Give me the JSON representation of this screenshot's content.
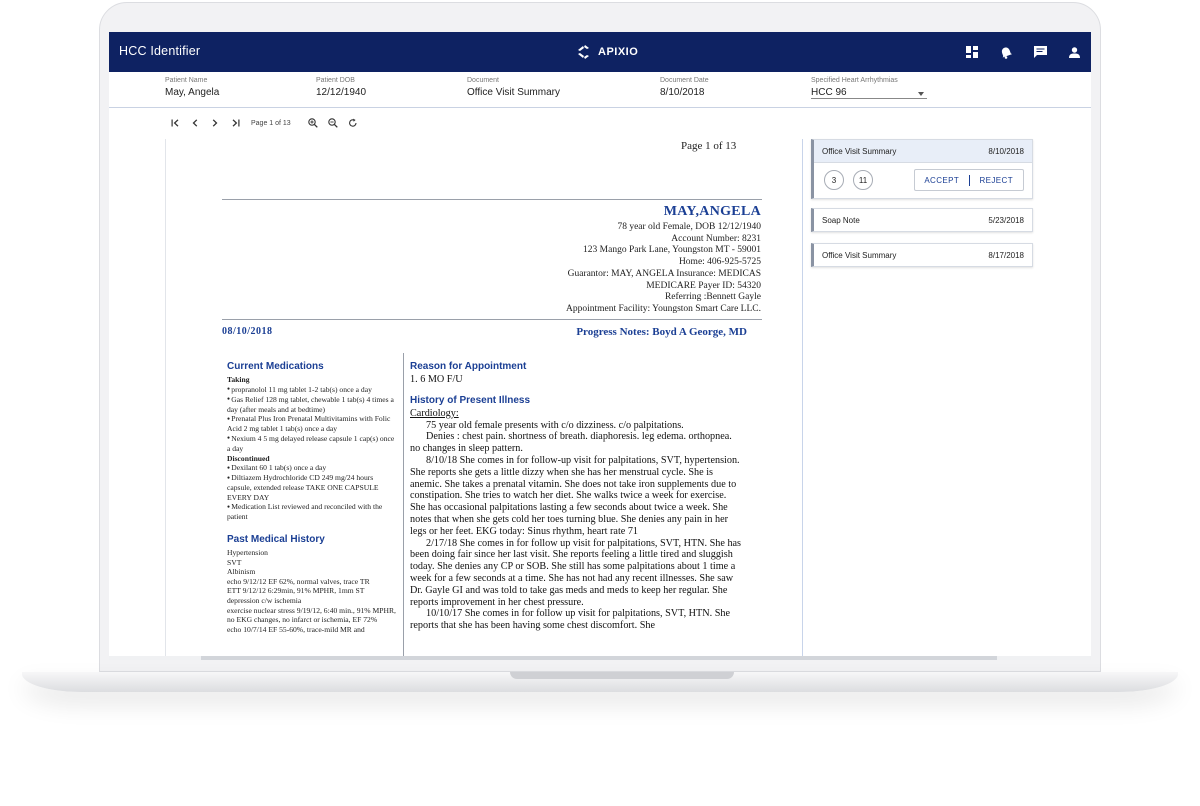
{
  "header": {
    "title": "HCC Identifier",
    "brand": "APIXIO"
  },
  "top_icons": [
    "dashboard-icon",
    "notification-bell-icon",
    "chat-icon",
    "user-icon"
  ],
  "meta": [
    {
      "label": "Patient Name",
      "value": "May, Angela"
    },
    {
      "label": "Patient DOB",
      "value": "12/12/1940"
    },
    {
      "label": "Document",
      "value": "Office Visit Summary"
    },
    {
      "label": "Document Date",
      "value": "8/10/2018"
    },
    {
      "label": "Specified Heart Arrhythmias",
      "value": "HCC 96"
    }
  ],
  "pager": {
    "page_info": "Page 1 of 13"
  },
  "document": {
    "page_label": "Page 1 of 13",
    "patient_name": "MAY,ANGELA",
    "address_lines": [
      "78  year old Female, DOB 12/12/1940",
      "Account Number: 8231",
      "123 Mango Park Lane, Youngston MT - 59001",
      "Home: 406-925-5725",
      "Guarantor: MAY, ANGELA Insurance: MEDICAS",
      "MEDICARE Payer ID: 54320",
      "Referring :Bennett Gayle",
      "Appointment Facility: Youngston Smart Care LLC."
    ],
    "visit_date": "08/10/2018",
    "progress_notes": "Progress Notes:  Boyd A George, MD",
    "current_medications_title": "Current Medications",
    "taking_label": "Taking",
    "taking": [
      "propranolol 11 mg tablet 1-2 tab(s) once a day",
      "Gas Relief 128 mg tablet, chewable 1 tab(s) 4 times a day (after meals and at bedtime)",
      "Prenatal Plus Iron Prenatal Multivitamins with Folic Acid 2 mg tablet 1 tab(s) once a day",
      "Nexium 4 5 mg delayed release capsule 1 cap(s) once a day"
    ],
    "discontinued_label": "Discontinued",
    "discontinued": [
      "Dexilant 60 1 tab(s) once a day",
      "Diltiazem Hydrochloride CD 249 mg/24 hours capsule, extended release TAKE ONE CAPSULE EVERY DAY",
      "Medication List reviewed and reconciled with the patient"
    ],
    "past_history_title": "Past Medical History",
    "past_history": [
      "Hypertension",
      "SVT",
      "Albinism",
      "echo 9/12/12 EF 62%, normal valves, trace TR",
      "ETT 9/12/12 6:29min, 91% MPHR, 1mm ST depression c/w ischemia",
      "exercise nuclear stress 9/19/12, 6:40 min., 91% MPHR, no EKG changes, no infarct or ischemia, EF 72%",
      "echo 10/7/14 EF 55-60%, trace-mild MR and"
    ],
    "reason_title": "Reason for Appointment",
    "reason": "1. 6 MO F/U",
    "hpi_title": "History of Present Illness",
    "cardiology": "Cardiology:",
    "hpi_1": "75 year old female presents with c/o dizziness.  c/o palpitations.",
    "hpi_2": "Denies : chest pain. shortness of breath. diaphoresis. leg edema. orthopnea. no changes in sleep pattern.",
    "hpi_3": "8/10/18 She comes in for follow-up visit for palpitations, SVT, hypertension. She reports she gets a little dizzy when she has her menstrual cycle. She is anemic. She takes a prenatal vitamin. She does not take iron supplements due to constipation. She tries to watch her diet. She walks twice a week for exercise. She has occasional palpitations lasting a few seconds about twice a week. She notes that when she gets cold her toes turning blue. She denies any pain in her legs or her feet. EKG today: Sinus rhythm, heart rate 71",
    "hpi_4": "2/17/18 She comes in for follow up visit for palpitations, SVT, HTN. She has been doing fair since her last visit. She reports feeling a little tired and sluggish today. She denies any CP or SOB. She still has some palpitations about 1 time a week for a few seconds at a time. She has not had any recent illnesses. She saw Dr. Gayle GI and was told to take gas meds and meds to keep her regular. She reports improvement in her chest pressure.",
    "hpi_5": "10/10/17 She comes in for follow up visit for palpitations, SVT, HTN. She reports that she has been having some chest discomfort. She"
  },
  "panel": {
    "items": [
      {
        "title": "Office Visit Summary",
        "date": "8/10/2018"
      },
      {
        "title": "Soap Note",
        "date": "5/23/2018"
      },
      {
        "title": "Office Visit Summary",
        "date": "8/17/2018"
      }
    ],
    "count_a": "3",
    "count_b": "11",
    "accept_label": "ACCEPT",
    "reject_label": "REJECT"
  },
  "colors": {
    "topbar": "#0e2262",
    "accent": "#1b3f94"
  }
}
